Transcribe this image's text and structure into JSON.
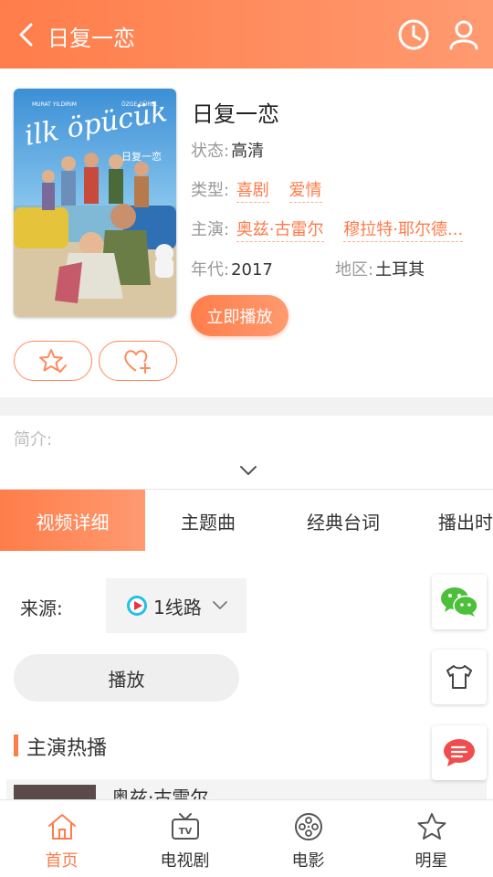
{
  "header": {
    "title": "日复一恋",
    "history_icon": "clock-icon",
    "profile_icon": "user-icon"
  },
  "movie": {
    "title": "日复一恋",
    "status_label": "状态:",
    "status": "高清",
    "genre_label": "类型:",
    "genres": [
      "喜剧",
      "爱情"
    ],
    "cast_label": "主演:",
    "cast": [
      "奥兹·古雷尔",
      "穆拉特·耶尔德..."
    ],
    "year_label": "年代:",
    "year": "2017",
    "region_label": "地区:",
    "region": "土耳其",
    "play_now": "立即播放",
    "poster_text": {
      "title_art": "ilk öpücük",
      "subtitle_art": "日复一恋",
      "actor_left": "MURAT YILDIRIM",
      "actor_right": "ÖZGE GÜREL"
    }
  },
  "intro": {
    "label": "简介:"
  },
  "tabs": [
    "视频详细",
    "主题曲",
    "经典台词",
    "播出时"
  ],
  "source": {
    "label": "来源:",
    "value": "1线路"
  },
  "play_button": "播放",
  "section": {
    "title": "主演热播"
  },
  "actor_preview": {
    "name": "奥兹·古雷尔"
  },
  "nav": [
    {
      "label": "首页",
      "icon": "home-icon",
      "active": true
    },
    {
      "label": "电视剧",
      "icon": "tv-icon",
      "active": false
    },
    {
      "label": "电影",
      "icon": "film-reel-icon",
      "active": false
    },
    {
      "label": "明星",
      "icon": "star-icon",
      "active": false
    }
  ],
  "colors": {
    "accent": "#ff7d4a",
    "accent_light": "#ff9a70",
    "wechat": "#4cbf3b",
    "feedback": "#f04e4e"
  }
}
